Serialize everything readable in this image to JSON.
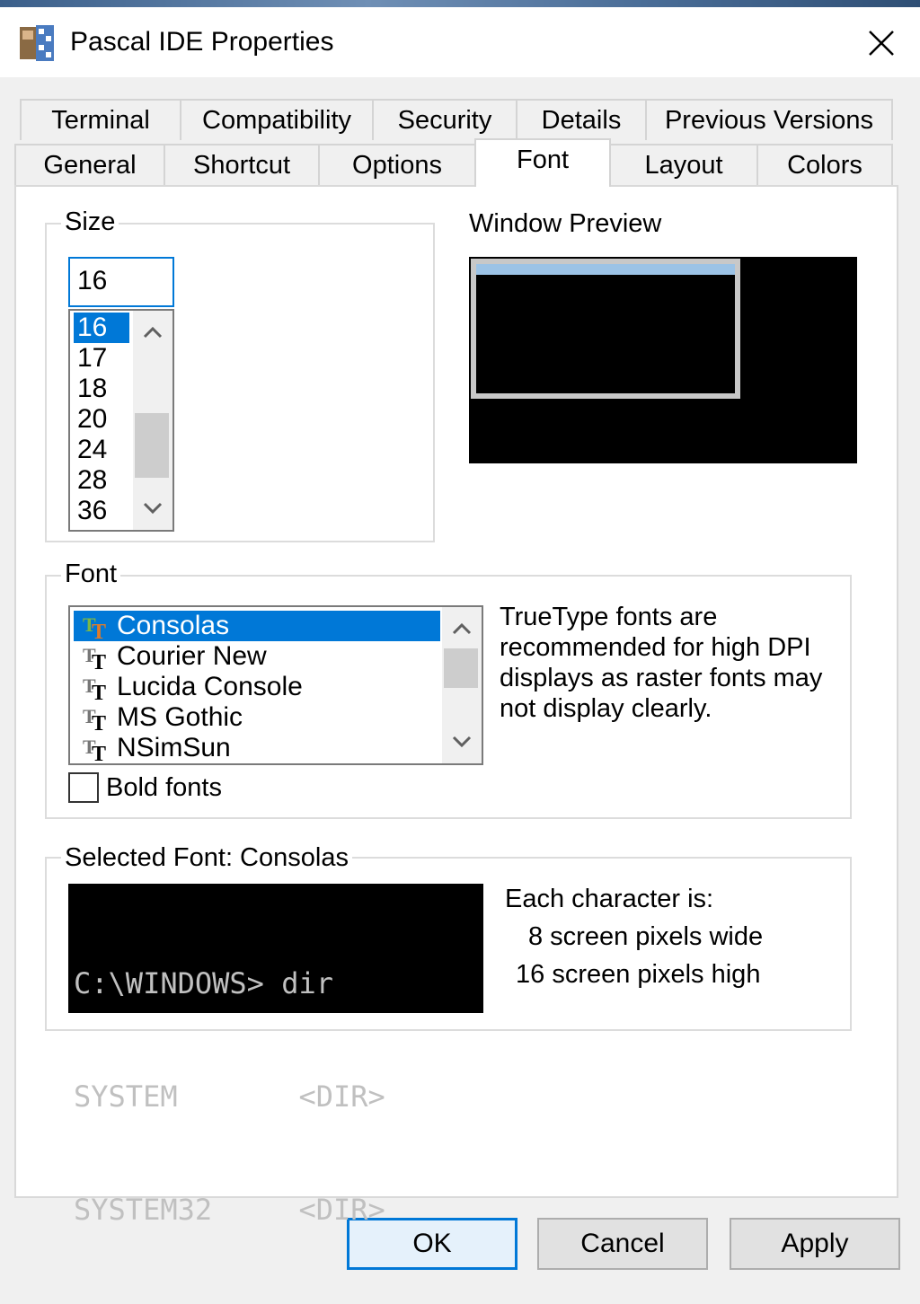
{
  "window": {
    "title": "Pascal IDE Properties",
    "close_icon": "close-icon"
  },
  "tabs_back_row": [
    {
      "label": "Terminal"
    },
    {
      "label": "Compatibility"
    },
    {
      "label": "Security"
    },
    {
      "label": "Details"
    },
    {
      "label": "Previous Versions"
    }
  ],
  "tabs_front_row": [
    {
      "label": "General"
    },
    {
      "label": "Shortcut"
    },
    {
      "label": "Options"
    },
    {
      "label": "Font",
      "active": true
    },
    {
      "label": "Layout"
    },
    {
      "label": "Colors"
    }
  ],
  "size_group": {
    "label": "Size",
    "current_value": "16",
    "options": [
      "16",
      "17",
      "18",
      "20",
      "24",
      "28",
      "36"
    ],
    "selected": "16"
  },
  "window_preview": {
    "label": "Window Preview"
  },
  "font_group": {
    "label": "Font",
    "fonts": [
      "Consolas",
      "Courier New",
      "Lucida Console",
      "MS Gothic",
      "NSimSun"
    ],
    "selected": "Consolas",
    "info": "TrueType fonts are recommended for high DPI displays as raster fonts may not display clearly.",
    "bold_label": "Bold fonts",
    "bold_checked": false
  },
  "selected_font_group": {
    "label": "Selected Font: Consolas",
    "sample_lines": [
      "C:\\WINDOWS> dir",
      "SYSTEM       <DIR>",
      "SYSTEM32     <DIR>"
    ],
    "char_info_title": "Each character is:",
    "width_line": "8 screen pixels wide",
    "height_line": "16 screen pixels high"
  },
  "buttons": {
    "ok": "OK",
    "cancel": "Cancel",
    "apply": "Apply"
  },
  "colors": {
    "accent": "#0078d7",
    "panel": "#ffffff",
    "background": "#f0f0f0"
  }
}
